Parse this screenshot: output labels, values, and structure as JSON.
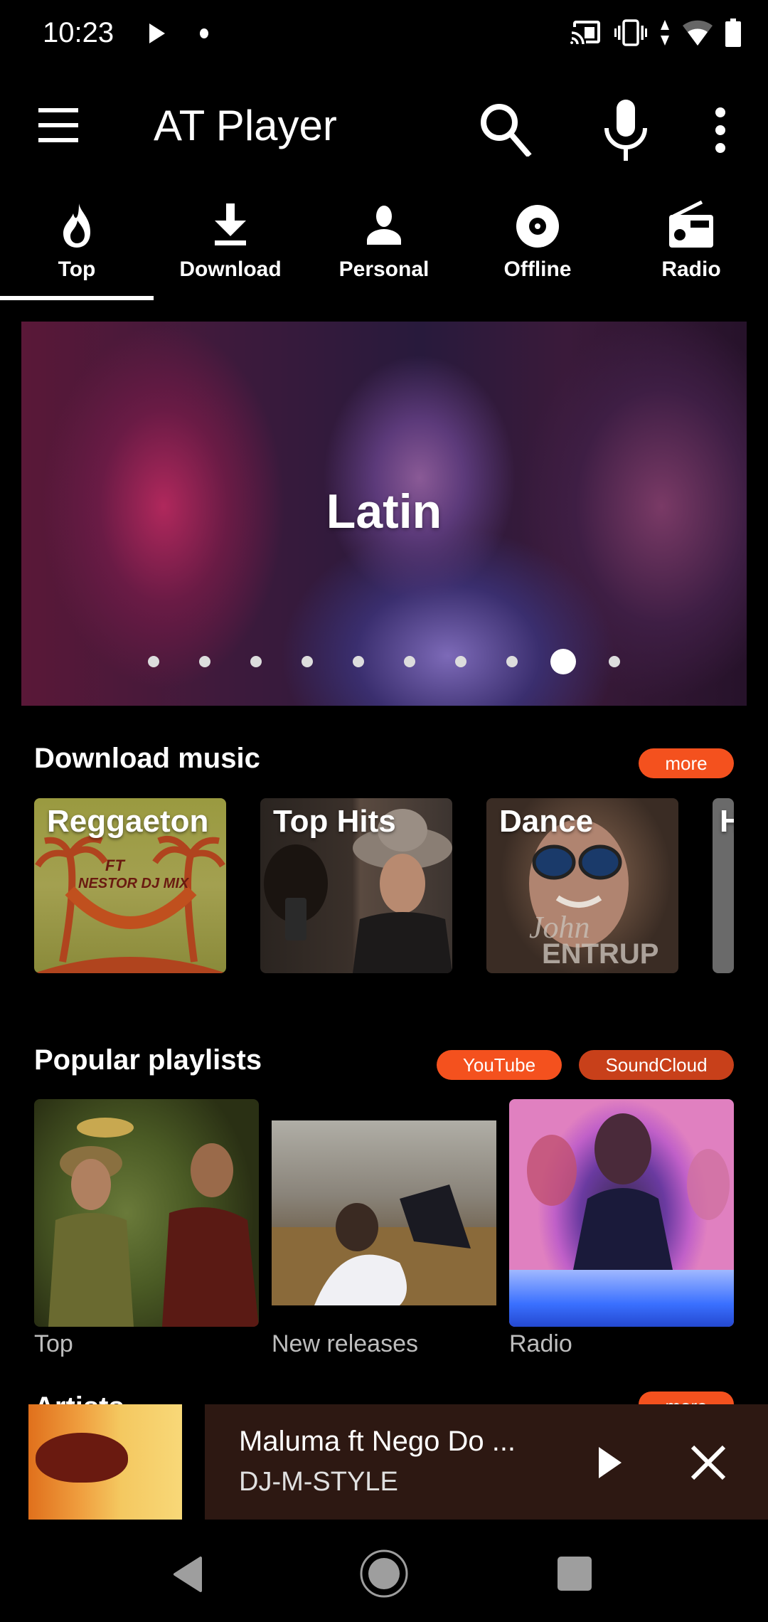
{
  "status_bar": {
    "time": "10:23",
    "icons": [
      "media-play-icon",
      "notification-dot-icon",
      "cast-icon",
      "vibrate-icon",
      "data-arrows-icon",
      "wifi-icon",
      "battery-icon"
    ]
  },
  "app_bar": {
    "title": "AT Player",
    "actions": [
      "menu-icon",
      "search-icon",
      "mic-icon",
      "more-vert-icon"
    ]
  },
  "tabs": [
    {
      "label": "Top",
      "icon": "fire-icon",
      "selected": true
    },
    {
      "label": "Download",
      "icon": "download-icon",
      "selected": false
    },
    {
      "label": "Personal",
      "icon": "person-icon",
      "selected": false
    },
    {
      "label": "Offline",
      "icon": "disc-icon",
      "selected": false
    },
    {
      "label": "Radio",
      "icon": "radio-icon",
      "selected": false
    }
  ],
  "hero": {
    "title": "Latin",
    "page_count": 10,
    "active_page_index": 8
  },
  "download_music": {
    "title": "Download music",
    "more_label": "more",
    "cards": [
      {
        "label": "Reggaeton"
      },
      {
        "label": "Top Hits"
      },
      {
        "label": "Dance"
      },
      {
        "label": "H"
      }
    ]
  },
  "popular_playlists": {
    "title": "Popular playlists",
    "sources": [
      {
        "label": "YouTube",
        "color": "#F4511E"
      },
      {
        "label": "SoundCloud",
        "color": "#C8401A"
      }
    ],
    "items": [
      {
        "label": "Top"
      },
      {
        "label": "New releases"
      },
      {
        "label": "Radio"
      }
    ]
  },
  "artists": {
    "title": "Artists",
    "more_label": "more"
  },
  "mini_player": {
    "title": "Maluma ft Nego Do ...",
    "artist": "DJ-M-STYLE",
    "background": "#2D1812"
  },
  "colors": {
    "accent": "#F4511E",
    "accent_dark": "#C8401A",
    "background": "#000000",
    "text_secondary": "#BDBDBD"
  }
}
